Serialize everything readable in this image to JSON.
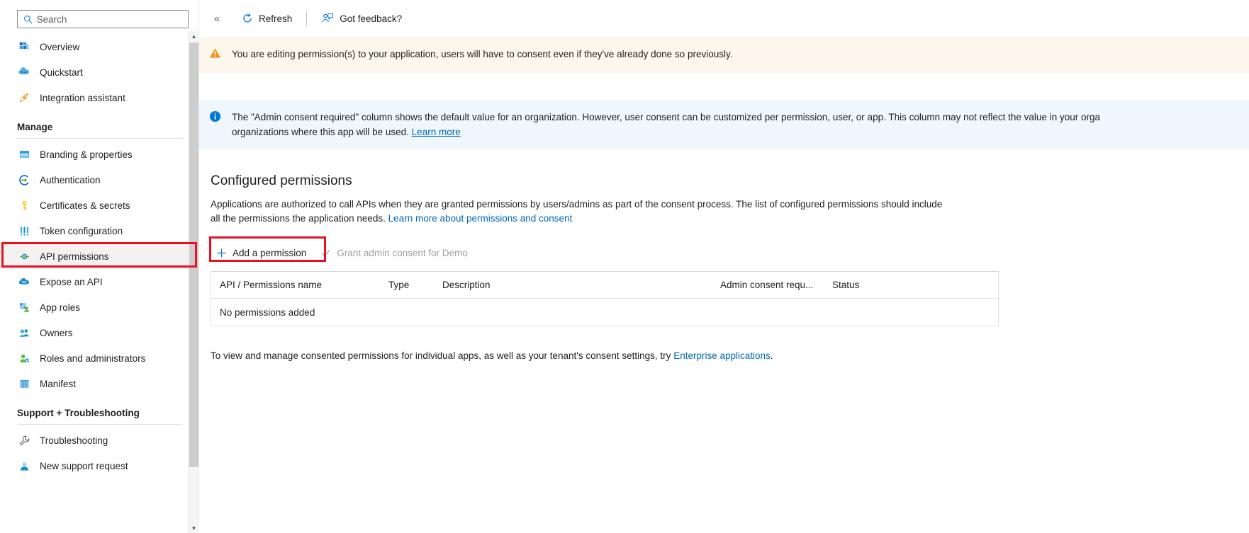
{
  "sidebar": {
    "search": {
      "placeholder": "Search",
      "value": "",
      "icon": "search-icon"
    },
    "items": [
      {
        "label": "Overview",
        "icon": "overview-grid-icon",
        "selected": false
      },
      {
        "label": "Quickstart",
        "icon": "quickstart-cloud-icon",
        "selected": false
      },
      {
        "label": "Integration assistant",
        "icon": "rocket-icon",
        "selected": false
      }
    ],
    "groups": [
      {
        "title": "Manage",
        "items": [
          {
            "label": "Branding & properties",
            "icon": "browser-window-icon",
            "selected": false
          },
          {
            "label": "Authentication",
            "icon": "authentication-arrow-icon",
            "selected": false
          },
          {
            "label": "Certificates & secrets",
            "icon": "key-icon",
            "selected": false
          },
          {
            "label": "Token configuration",
            "icon": "token-bars-icon",
            "selected": false
          },
          {
            "label": "API permissions",
            "icon": "api-key-node-icon",
            "selected": true
          },
          {
            "label": "Expose an API",
            "icon": "expose-api-cloud-icon",
            "selected": false
          },
          {
            "label": "App roles",
            "icon": "app-roles-grid-person-icon",
            "selected": false
          },
          {
            "label": "Owners",
            "icon": "owners-people-icon",
            "selected": false
          },
          {
            "label": "Roles and administrators",
            "icon": "roles-admin-person-icon",
            "selected": false
          },
          {
            "label": "Manifest",
            "icon": "manifest-braces-icon",
            "selected": false
          }
        ]
      },
      {
        "title": "Support + Troubleshooting",
        "items": [
          {
            "label": "Troubleshooting",
            "icon": "wrench-icon",
            "selected": false
          },
          {
            "label": "New support request",
            "icon": "support-person-icon",
            "selected": false
          }
        ]
      }
    ]
  },
  "toolbar": {
    "collapse_label": "«",
    "refresh_label": "Refresh",
    "refresh_icon": "refresh-icon",
    "feedback_label": "Got feedback?",
    "feedback_icon": "feedback-person-icon"
  },
  "banners": {
    "warning": {
      "icon": "warning-triangle-icon",
      "text": "You are editing permission(s) to your application, users will have to consent even if they've already done so previously."
    },
    "info": {
      "icon": "info-circle-icon",
      "line1": "The \"Admin consent required\" column shows the default value for an organization. However, user consent can be customized per permission, user, or app. This column may not reflect the value in your orga",
      "line2": "organizations where this app will be used.",
      "learn_more": "Learn more"
    }
  },
  "main": {
    "section_title": "Configured permissions",
    "desc_line1": "Applications are authorized to call APIs when they are granted permissions by users/admins as part of the consent process. The list of configured permissions should include",
    "desc_line2": "all the permissions the application needs.",
    "desc_link": "Learn more about permissions and consent",
    "add_permission_label": "Add a permission",
    "add_permission_icon": "plus-icon",
    "grant_consent_label": "Grant admin consent for Demo",
    "grant_consent_icon": "checkmark-icon",
    "table": {
      "headers": [
        "API / Permissions name",
        "Type",
        "Description",
        "Admin consent requ...",
        "Status"
      ],
      "empty_message": "No permissions added"
    },
    "footer_prefix": "To view and manage consented permissions for individual apps, as well as your tenant's consent settings, try ",
    "footer_link": "Enterprise applications",
    "footer_suffix": "."
  },
  "colors": {
    "accent": "#0078d4",
    "link": "#0067b8",
    "annotation": "#e81123",
    "warning_bg": "#fdf6ec",
    "info_bg": "#eff6fc",
    "selected_bg": "#f3f2f1"
  }
}
